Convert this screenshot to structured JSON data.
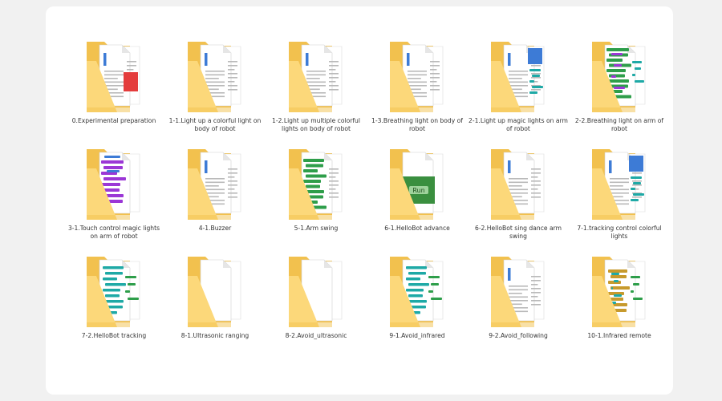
{
  "colors": {
    "folder_back": "#f2c14e",
    "folder_front": "#fcd87a",
    "paper": "#ffffff",
    "block_green": "#2e9e4a",
    "block_cyan": "#1ea9a6",
    "block_blue": "#3d7bd6",
    "block_purple": "#9b37d6",
    "block_red": "#e43c3c"
  },
  "folders": [
    {
      "label": "0.Experimental preparation",
      "icon": "folder-icon",
      "preview": "red"
    },
    {
      "label": "1-1.Light up a colorful light on body of robot",
      "icon": "folder-icon",
      "preview": "doc"
    },
    {
      "label": "1-2.Light up multiple colorful lights on body of robot",
      "icon": "folder-icon",
      "preview": "doc"
    },
    {
      "label": "1-3.Breathing light on body of robot",
      "icon": "folder-icon",
      "preview": "doc"
    },
    {
      "label": "2-1.Light up magic lights on arm of robot",
      "icon": "folder-icon",
      "preview": "cyan"
    },
    {
      "label": "2-2.Breathing light on arm of robot",
      "icon": "folder-icon",
      "preview": "green-dense"
    },
    {
      "label": "3-1.Touch control magic lights on arm of robot",
      "icon": "folder-icon",
      "preview": "purple"
    },
    {
      "label": "4-1.Buzzer",
      "icon": "folder-icon",
      "preview": "doc"
    },
    {
      "label": "5-1.Arm swing",
      "icon": "folder-icon",
      "preview": "green"
    },
    {
      "label": "6-1.HelloBot advance",
      "icon": "folder-icon",
      "preview": "run"
    },
    {
      "label": "6-2.HelloBot sing dance arm swing",
      "icon": "folder-icon",
      "preview": "doc"
    },
    {
      "label": "7-1.tracking control colorful lights",
      "icon": "folder-icon",
      "preview": "cyan"
    },
    {
      "label": "7-2.HelloBot tracking",
      "icon": "folder-icon",
      "preview": "cyan-bars"
    },
    {
      "label": "8-1.Ultrasonic ranging",
      "icon": "folder-icon",
      "preview": "blank"
    },
    {
      "label": "8-2.Avoid_ultrasonic",
      "icon": "folder-icon",
      "preview": "blank"
    },
    {
      "label": "9-1.Avoid_infrared",
      "icon": "folder-icon",
      "preview": "cyan-bars"
    },
    {
      "label": "9-2.Avoid_following",
      "icon": "folder-icon",
      "preview": "doc"
    },
    {
      "label": "10-1.Infrared remote",
      "icon": "folder-icon",
      "preview": "mixed"
    }
  ],
  "run_text": "Run"
}
